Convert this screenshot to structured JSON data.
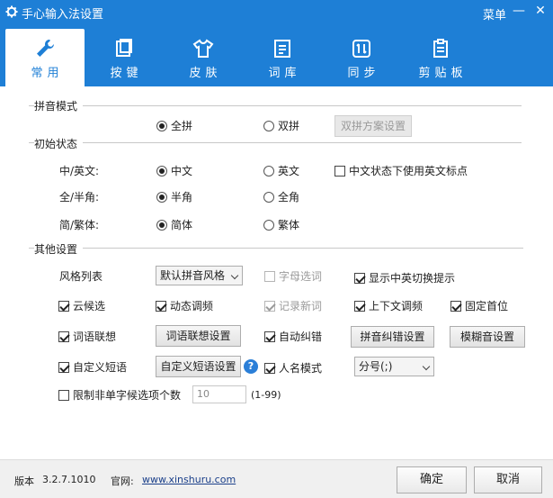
{
  "window": {
    "title": "手心输入法设置",
    "menu_label": "菜单",
    "minimize_label": "—",
    "close_label": "✕"
  },
  "tabs": [
    {
      "label": "常用",
      "icon": "wrench-icon",
      "active": true
    },
    {
      "label": "按键",
      "icon": "keyboard-icon",
      "active": false
    },
    {
      "label": "皮肤",
      "icon": "tshirt-icon",
      "active": false
    },
    {
      "label": "词库",
      "icon": "dictionary-icon",
      "active": false
    },
    {
      "label": "同步",
      "icon": "sync-icon",
      "active": false
    },
    {
      "label": "剪贴板",
      "icon": "clipboard-icon",
      "active": false
    }
  ],
  "pinyin_mode": {
    "title": "拼音模式",
    "full_label": "全拼",
    "double_label": "双拼",
    "double_scheme_button": "双拼方案设置",
    "selected": "全拼"
  },
  "initial_state": {
    "title": "初始状态",
    "cn_en": {
      "label": "中/英文:",
      "opt1": "中文",
      "opt2": "英文",
      "selected": "中文"
    },
    "cn_en_punct_checkbox": {
      "label": "中文状态下使用英文标点",
      "checked": false
    },
    "width": {
      "label": "全/半角:",
      "opt1": "半角",
      "opt2": "全角",
      "selected": "半角"
    },
    "script": {
      "label": "简/繁体:",
      "opt1": "简体",
      "opt2": "繁体",
      "selected": "简体"
    }
  },
  "other_settings": {
    "title": "其他设置",
    "style_list_label": "风格列表",
    "style_select_value": "默认拼音风格",
    "letter_select": {
      "label": "字母选词",
      "checked": false,
      "disabled": true
    },
    "show_switch_tip": {
      "label": "显示中英切换提示",
      "checked": true
    },
    "cloud_candidate": {
      "label": "云候选",
      "checked": true
    },
    "dynamic_freq": {
      "label": "动态调频",
      "checked": true
    },
    "record_new_words": {
      "label": "记录新词",
      "checked": true,
      "disabled": true
    },
    "context_freq": {
      "label": "上下文调频",
      "checked": true
    },
    "fixed_first": {
      "label": "固定首位",
      "checked": true
    },
    "word_association": {
      "label": "词语联想",
      "checked": true
    },
    "word_association_button": "词语联想设置",
    "auto_correct": {
      "label": "自动纠错",
      "checked": true
    },
    "pinyin_correct_button": "拼音纠错设置",
    "fuzzy_button": "模糊音设置",
    "custom_phrase": {
      "label": "自定义短语",
      "checked": true
    },
    "custom_phrase_button": "自定义短语设置",
    "help_glyph": "?",
    "name_mode": {
      "label": "人名模式",
      "checked": true
    },
    "name_mode_select_value": "分号(;)",
    "limit_candidates": {
      "label": "限制非单字候选项个数",
      "checked": false
    },
    "limit_value": "10",
    "limit_range": "(1-99)"
  },
  "footer": {
    "version_label": "版本",
    "version_value": "3.2.7.1010",
    "website_label": "官网:",
    "website_link": "www.xinshuru.com",
    "ok_button": "确定",
    "cancel_button": "取消"
  },
  "colors": {
    "accent": "#1e7fd6",
    "help": "#2b7fd8"
  }
}
